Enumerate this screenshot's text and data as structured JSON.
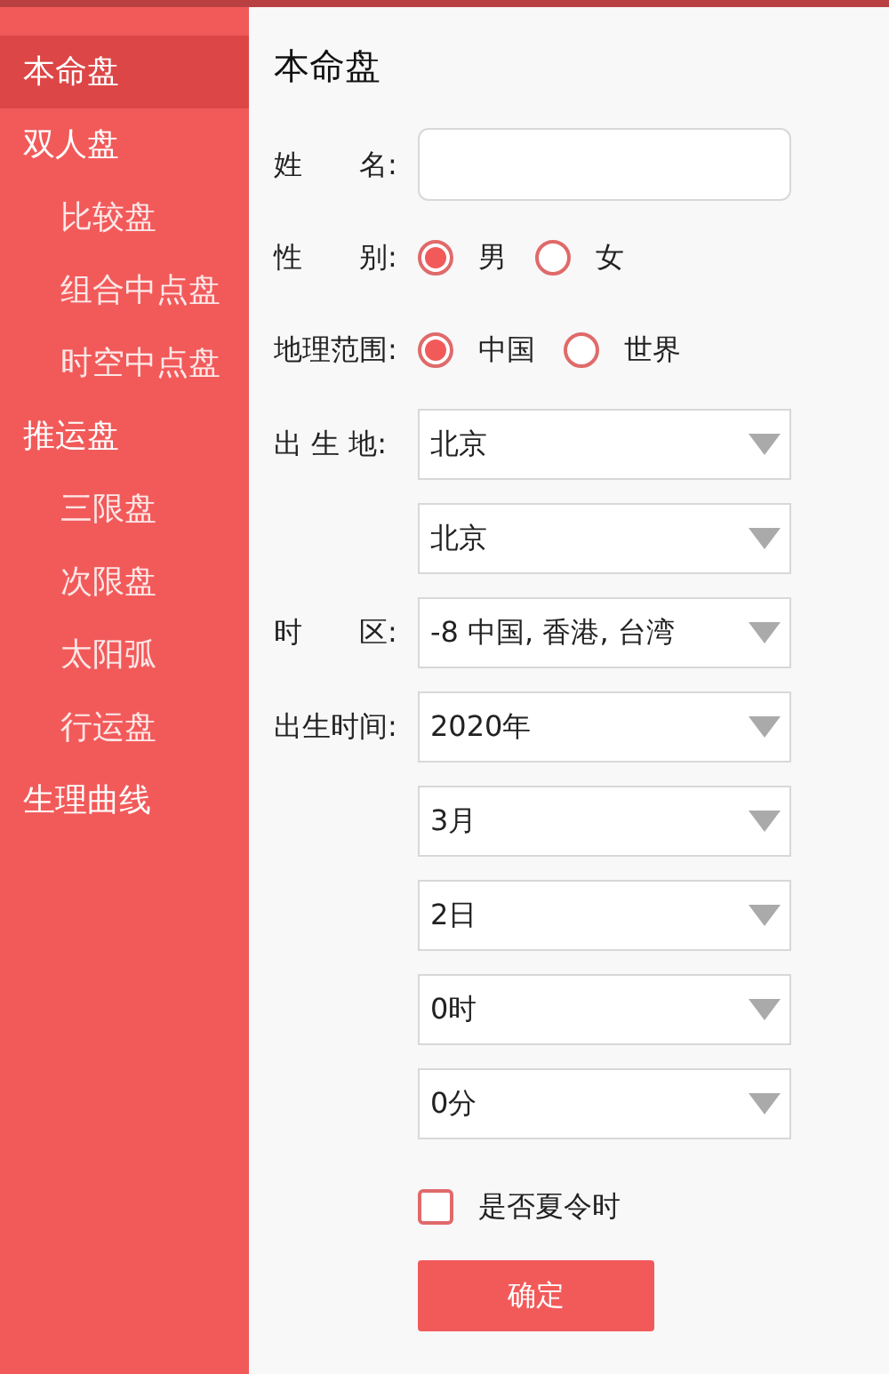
{
  "sidebar": {
    "items": [
      {
        "label": "本命盘",
        "selected": true
      },
      {
        "label": "双人盘",
        "selected": false,
        "children": [
          {
            "label": "比较盘",
            "selected": false
          },
          {
            "label": "组合中点盘",
            "selected": false
          },
          {
            "label": "时空中点盘",
            "selected": false
          }
        ]
      },
      {
        "label": "推运盘",
        "selected": false,
        "children": [
          {
            "label": "三限盘",
            "selected": false
          },
          {
            "label": "次限盘",
            "selected": false
          },
          {
            "label": "太阳弧",
            "selected": false
          },
          {
            "label": "行运盘",
            "selected": false
          }
        ]
      },
      {
        "label": "生理曲线",
        "selected": false
      }
    ]
  },
  "page_title": "本命盘",
  "form": [
    {
      "kind": "text",
      "label": "姓　　名:"
    },
    {
      "kind": "radio",
      "label": "性　　别:",
      "options": [
        {
          "label": "男",
          "selected": true
        },
        {
          "label": "女",
          "selected": false
        }
      ]
    },
    {
      "kind": "radio",
      "label": "地理范围:",
      "options": [
        {
          "label": "中国",
          "selected": true
        },
        {
          "label": "世界",
          "selected": false
        }
      ]
    },
    {
      "kind": "select",
      "label": "出 生 地:",
      "value": "北京"
    },
    {
      "kind": "select",
      "value": "北京"
    },
    {
      "kind": "select",
      "label": "时　　区:",
      "value": "-8 中国, 香港, 台湾"
    },
    {
      "kind": "select",
      "label": "出生时间:",
      "value": "2020年"
    },
    {
      "kind": "select",
      "value": "3月"
    },
    {
      "kind": "select",
      "value": "2日"
    },
    {
      "kind": "select",
      "value": "0时"
    },
    {
      "kind": "select",
      "value": "0分"
    },
    {
      "kind": "checkbox",
      "label": "是否夏令时",
      "checked": false
    },
    {
      "kind": "button",
      "label": "确定"
    }
  ]
}
